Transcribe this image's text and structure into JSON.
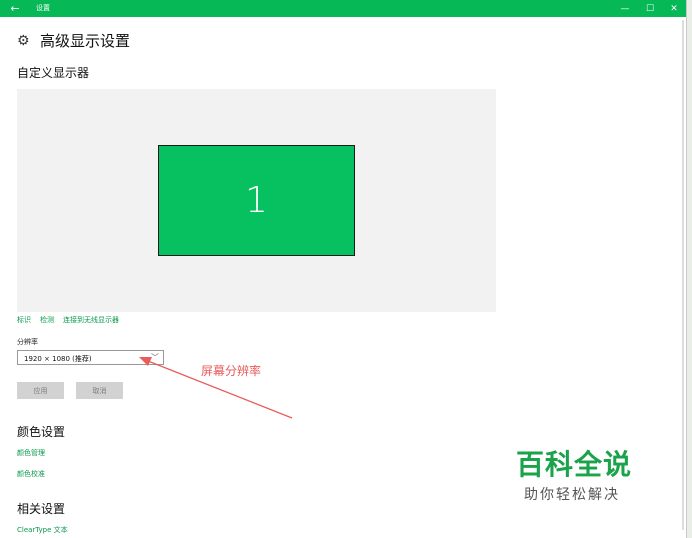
{
  "window": {
    "title": "设置",
    "back_icon": "←",
    "minimize_icon": "—",
    "maximize_icon": "☐",
    "close_icon": "✕"
  },
  "page": {
    "gear_icon": "⚙",
    "title": "高级显示设置"
  },
  "customize": {
    "title": "自定义显示器",
    "monitor_number": "1",
    "links": [
      "标识",
      "检测",
      "连接到无线显示器"
    ]
  },
  "resolution": {
    "label": "分辨率",
    "value": "1920 × 1080 (推荐)",
    "chevron_icon": "﹀"
  },
  "buttons": {
    "apply": "应用",
    "cancel": "取消"
  },
  "color": {
    "title": "颜色设置",
    "items": [
      "颜色管理",
      "颜色校准"
    ]
  },
  "related": {
    "title": "相关设置",
    "items": [
      "ClearType 文本"
    ]
  },
  "annotation": {
    "text": "屏幕分辨率",
    "color": "#e85c5c"
  },
  "watermark": {
    "title": "百科全说",
    "subtitle": "助你轻松解决"
  },
  "colors": {
    "accent": "#07b856",
    "monitor": "#07c160",
    "link": "#0a9a4d"
  }
}
